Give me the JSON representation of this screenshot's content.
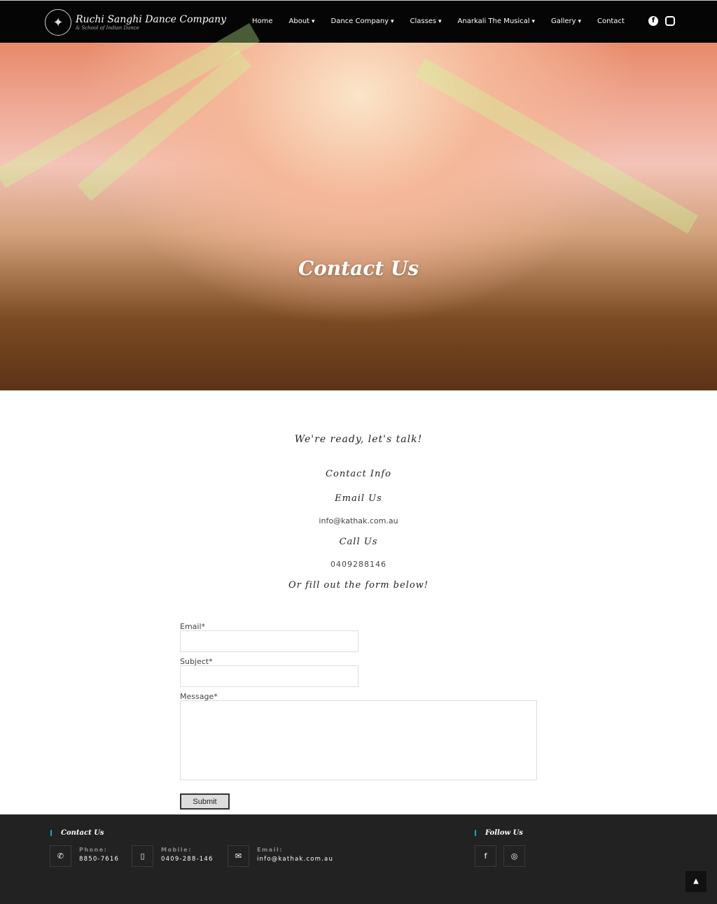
{
  "header": {
    "logo_title": "Ruchi Sanghi Dance Company",
    "logo_subtitle": "& School of Indian Dance",
    "menu": [
      "Home",
      "About",
      "Dance Company",
      "Classes",
      "Anarkali The Musical",
      "Gallery",
      "Contact"
    ]
  },
  "hero": {
    "title": "Contact Us"
  },
  "main": {
    "tagline": "We're ready, let's talk!",
    "contact_info": "Contact Info",
    "email_heading": "Email Us",
    "email": "info@kathak.com.au",
    "call_heading": "Call Us",
    "phone": "0409288146",
    "form_heading": "Or fill out the form below!"
  },
  "form": {
    "email_label": "Email*",
    "subject_label": "Subject*",
    "message_label": "Message*",
    "submit": "Submit"
  },
  "footer": {
    "contact_heading": "Contact Us",
    "follow_heading": "Follow Us",
    "phone_label": "Phone:",
    "phone": "8850-7616",
    "mobile_label": "Mobile:",
    "mobile": "0409-288-146",
    "email_label": "Email:",
    "email": "info@kathak.com.au",
    "accent": "#1e9fc7"
  }
}
